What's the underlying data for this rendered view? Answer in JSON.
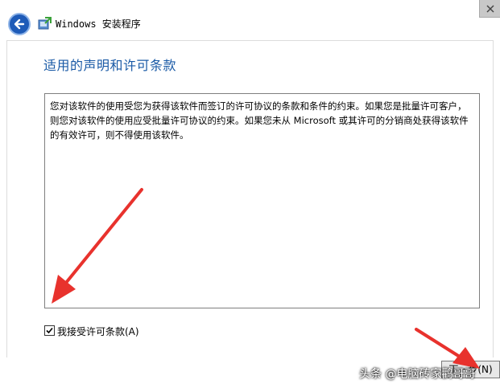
{
  "window": {
    "title": "Windows 安装程序"
  },
  "page": {
    "heading": "适用的声明和许可条款",
    "license_text": "您对该软件的使用受您为获得该软件而签订的许可协议的条款和条件的约束。如果您是批量许可客户，则您对该软件的使用应受批量许可协议的约束。如果您未从 Microsoft 或其许可的分销商处获得该软件的有效许可，则不得使用该软件。",
    "accept_checkbox": {
      "label": "我接受许可条款(A)",
      "checked": true
    },
    "next_button": {
      "label": "下一步(N)"
    }
  },
  "watermark": {
    "text": "头条 @电脑砖家鹳哥哥"
  },
  "colors": {
    "heading": "#1a5aa6",
    "back_button": "#1e5bb8",
    "annotation_arrow": "#e8322d"
  }
}
